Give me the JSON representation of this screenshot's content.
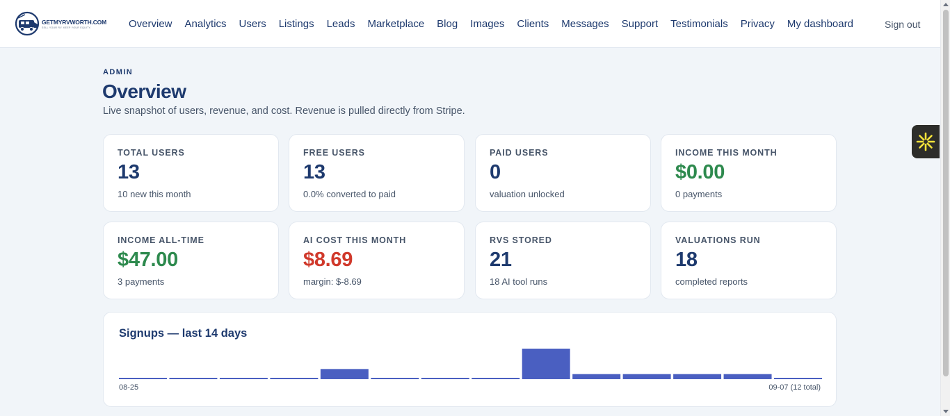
{
  "brand": {
    "name": "GETMYRVWORTH.COM",
    "tagline": "SELL YOUR RV. KEEP YOUR EQUITY."
  },
  "nav": {
    "items": [
      "Overview",
      "Analytics",
      "Users",
      "Listings",
      "Leads",
      "Marketplace",
      "Blog",
      "Images",
      "Clients",
      "Messages",
      "Support",
      "Testimonials",
      "Privacy",
      "My dashboard"
    ],
    "sign_out": "Sign out"
  },
  "header": {
    "eyebrow": "ADMIN",
    "title": "Overview",
    "subtitle": "Live snapshot of users, revenue, and cost. Revenue is pulled directly from Stripe."
  },
  "stats": [
    {
      "label": "TOTAL USERS",
      "value": "13",
      "note": "10 new this month",
      "tone": "default"
    },
    {
      "label": "FREE USERS",
      "value": "13",
      "note": "0.0% converted to paid",
      "tone": "default"
    },
    {
      "label": "PAID USERS",
      "value": "0",
      "note": "valuation unlocked",
      "tone": "default"
    },
    {
      "label": "INCOME THIS MONTH",
      "value": "$0.00",
      "note": "0 payments",
      "tone": "green"
    },
    {
      "label": "INCOME ALL-TIME",
      "value": "$47.00",
      "note": "3 payments",
      "tone": "green"
    },
    {
      "label": "AI COST THIS MONTH",
      "value": "$8.69",
      "note": "margin: $-8.69",
      "tone": "red"
    },
    {
      "label": "RVS STORED",
      "value": "21",
      "note": "18 AI tool runs",
      "tone": "default"
    },
    {
      "label": "VALUATIONS RUN",
      "value": "18",
      "note": "completed reports",
      "tone": "default"
    }
  ],
  "colors": {
    "bar": "#4a5fc1",
    "navy": "#1e3a6e",
    "green": "#2e8a4e",
    "red": "#d0392b"
  },
  "chart_data": {
    "type": "bar",
    "title": "Signups — last 14 days",
    "x_start_label": "08-25",
    "x_end_label": "09-07 (12 total)",
    "values": [
      0,
      0,
      0,
      0,
      2,
      0,
      0,
      0,
      6,
      1,
      1,
      1,
      1,
      0
    ],
    "ylim": [
      0,
      6
    ]
  }
}
